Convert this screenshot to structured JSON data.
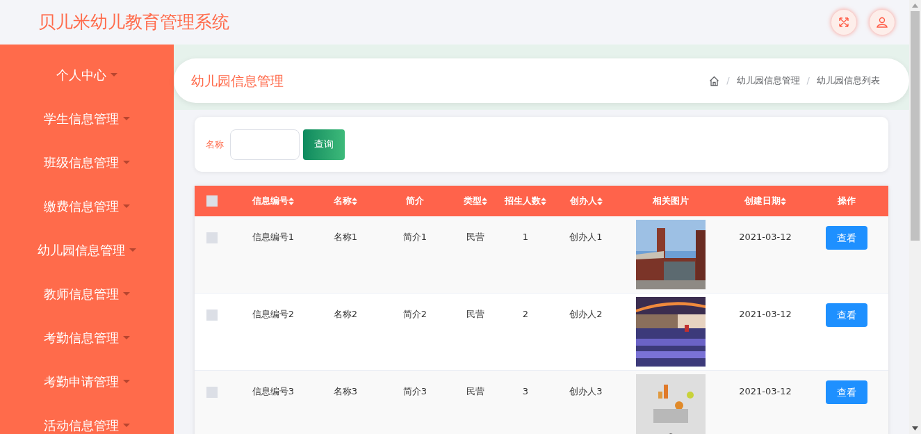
{
  "app_title": "贝儿米幼儿教育管理系统",
  "header_buttons": [
    {
      "kind": "fullscreen"
    },
    {
      "kind": "user"
    }
  ],
  "sidebar": {
    "items": [
      {
        "label": "个人中心"
      },
      {
        "label": "学生信息管理"
      },
      {
        "label": "班级信息管理"
      },
      {
        "label": "缴费信息管理"
      },
      {
        "label": "幼儿园信息管理"
      },
      {
        "label": "教师信息管理"
      },
      {
        "label": "考勤信息管理"
      },
      {
        "label": "考勤申请管理"
      },
      {
        "label": "活动信息管理"
      }
    ]
  },
  "page_title": "幼儿园信息管理",
  "breadcrumb": [
    {
      "separator": "/",
      "label": "幼儿园信息管理"
    },
    {
      "separator": "/",
      "label": "幼儿园信息列表"
    }
  ],
  "search": {
    "label": "名称",
    "button": "查询"
  },
  "table": {
    "select_all_checked": false,
    "columns": [
      {
        "label": "信息编号",
        "sortable": true
      },
      {
        "label": "名称",
        "sortable": true
      },
      {
        "label": "简介",
        "sortable": false
      },
      {
        "label": "类型",
        "sortable": true
      },
      {
        "label": "招生人数",
        "sortable": true
      },
      {
        "label": "创办人",
        "sortable": true
      },
      {
        "label": "相关图片",
        "sortable": false
      },
      {
        "label": "创建日期",
        "sortable": true
      },
      {
        "label": "操作",
        "sortable": false
      }
    ],
    "rows": [
      {
        "checked": false,
        "code": "信息编号1",
        "name": "名称1",
        "intro": "简介1",
        "type": "民营",
        "enrollment": "1",
        "founder": "创办人1",
        "date": "2021-03-12",
        "action": "查看"
      },
      {
        "checked": false,
        "code": "信息编号2",
        "name": "名称2",
        "intro": "简介2",
        "type": "民营",
        "enrollment": "2",
        "founder": "创办人2",
        "date": "2021-03-12",
        "action": "查看"
      },
      {
        "checked": false,
        "code": "信息编号3",
        "name": "名称3",
        "intro": "简介3",
        "type": "民营",
        "enrollment": "3",
        "founder": "创办人3",
        "date": "2021-03-12",
        "action": "查看"
      }
    ]
  }
}
